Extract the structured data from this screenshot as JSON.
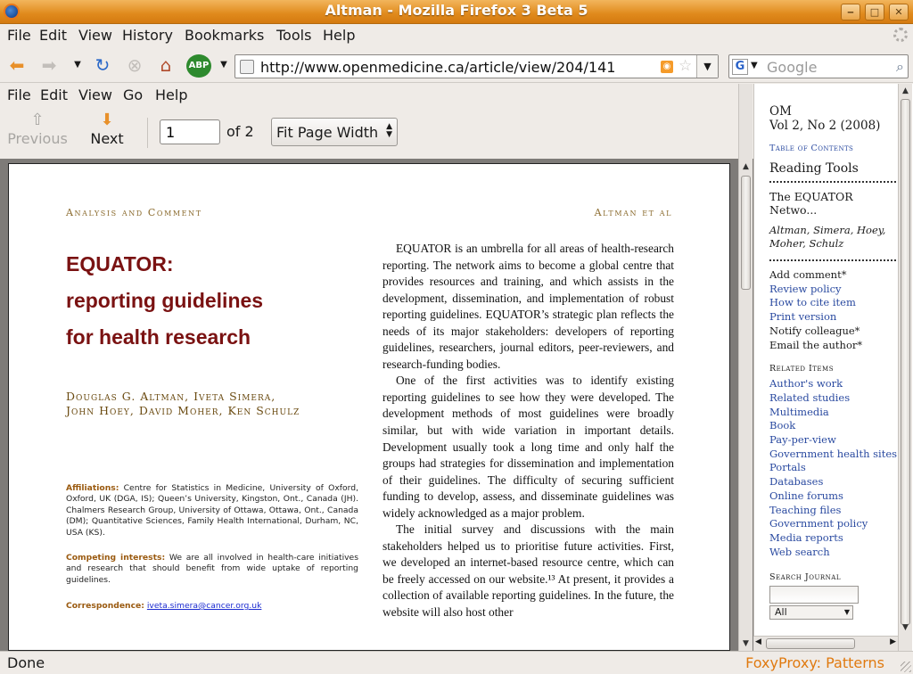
{
  "window": {
    "title": "Altman - Mozilla Firefox 3 Beta 5"
  },
  "menu": [
    {
      "label": "File"
    },
    {
      "label": "Edit"
    },
    {
      "label": "View"
    },
    {
      "label": "History"
    },
    {
      "label": "Bookmarks"
    },
    {
      "label": "Tools"
    },
    {
      "label": "Help"
    }
  ],
  "nav": {
    "url": "http://www.openmedicine.ca/article/view/204/141",
    "search_placeholder": "Google",
    "search_engine": "G",
    "adblock_label": "ABP"
  },
  "viewer": {
    "menu": [
      {
        "label": "File"
      },
      {
        "label": "Edit"
      },
      {
        "label": "View"
      },
      {
        "label": "Go"
      },
      {
        "label": "Help"
      }
    ],
    "previous_label": "Previous",
    "next_label": "Next",
    "page_value": "1",
    "of_pages": "of 2",
    "zoom": "Fit Page Width"
  },
  "pdf": {
    "header_left": "Analysis and Comment",
    "header_right": "Altman et al",
    "title_lines": [
      "EQUATOR:",
      "reporting guidelines",
      "for health research"
    ],
    "authors_lines": [
      "Douglas G. Altman, Iveta Simera,",
      "John Hoey, David Moher, Ken Schulz"
    ],
    "affiliations_label": "Affiliations:",
    "affiliations_text": " Centre for Statistics in Medicine, University of Oxford, Oxford, UK (DGA, IS); Queen’s University, Kingston, Ont., Canada (JH). Chalmers Research Group, University of Ottawa, Ottawa, Ont., Canada (DM); Quantitative Sciences, Family Health International, Durham, NC, USA (KS).",
    "competing_label": "Competing interests:",
    "competing_text": " We are all involved in health-care initiatives and research that should benefit from wide uptake of reporting guidelines.",
    "correspondence_label": "Correspondence:",
    "correspondence_email": "iveta.simera@cancer.org.uk",
    "paragraphs": [
      "EQUATOR is an umbrella for all areas of health-research reporting. The network aims to become a global centre that provides resources and training, and which assists in the development, dissemination, and implementation of robust reporting guidelines. EQUATOR’s strategic plan reflects the needs of its major stakeholders: developers of reporting guidelines, researchers, journal editors, peer-reviewers, and research-funding bodies.",
      "One of the first activities was to identify existing reporting guidelines to see how they were developed. The development methods of most guidelines were broadly similar, but with wide variation in important details. Development usually took a long time and only half the groups had strategies for dissemination and implementation of their guidelines. The difficulty of securing sufficient funding to develop, assess, and disseminate guidelines was widely acknowledged as a major problem.",
      "The initial survey and discussions with the main stakeholders helped us to prioritise future activities. First, we developed an internet-based resource centre, which can be freely accessed on our website.¹³ At present, it provides a collection of available reporting guidelines. In the future, the website will also host other"
    ]
  },
  "sidebar": {
    "journal": "OM",
    "issue": "Vol 2, No 2 (2008)",
    "toc": "Table of Contents",
    "reading_tools": "Reading Tools",
    "article_title": "The EQUATOR Netwo...",
    "article_authors": "Altman, Simera, Hoey, Moher, Schulz",
    "tools": [
      {
        "label": "Add comment*",
        "link": false
      },
      {
        "label": "Review policy",
        "link": true
      },
      {
        "label": "How to cite item",
        "link": true
      },
      {
        "label": "Print version",
        "link": true
      },
      {
        "label": "Notify colleague*",
        "link": false
      },
      {
        "label": "Email the author*",
        "link": false
      }
    ],
    "related_heading": "Related Items",
    "related": [
      "Author's work",
      "Related studies",
      "Multimedia",
      "Book",
      "Pay-per-view",
      "Government health sites",
      "Portals",
      "Databases",
      "Online forums",
      "Teaching files",
      "Government policy",
      "Media reports",
      "Web search"
    ],
    "search_heading": "Search Journal",
    "search_scope": "All"
  },
  "status": {
    "left": "Done",
    "right": "FoxyProxy: Patterns"
  },
  "colors": {
    "titlebar": "#e08a1c",
    "title_red": "#7a1212",
    "link_blue": "#2a4aa0",
    "proxy_orange": "#e07a10"
  }
}
